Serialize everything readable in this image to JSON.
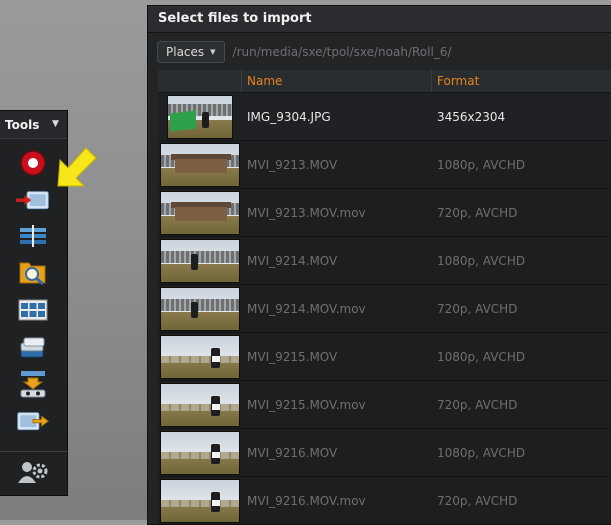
{
  "tools_panel": {
    "title": "Tools",
    "collapse_glyph": "▼",
    "tools": [
      {
        "name": "record-icon"
      },
      {
        "name": "import-icon"
      },
      {
        "name": "timeline-icon"
      },
      {
        "name": "media-browser-icon"
      },
      {
        "name": "grid-view-icon"
      },
      {
        "name": "stack-layers-icon"
      },
      {
        "name": "render-queue-icon"
      },
      {
        "name": "export-icon"
      },
      {
        "name": "users-settings-icon"
      }
    ]
  },
  "dialog": {
    "title": "Select files to import",
    "places_label": "Places",
    "path": "/run/media/sxe/tpol/sxe/noah/Roll_6/",
    "columns": {
      "name": "Name",
      "format": "Format"
    },
    "files": [
      {
        "name": "IMG_9304.JPG",
        "format": "3456x2304",
        "thumb": "greenscreen"
      },
      {
        "name": "MVI_9213.MOV",
        "format": "1080p, AVCHD",
        "thumb": "building"
      },
      {
        "name": "MVI_9213.MOV.mov",
        "format": "720p, AVCHD",
        "thumb": "building"
      },
      {
        "name": "MVI_9214.MOV",
        "format": "1080p, AVCHD",
        "thumb": "field-person"
      },
      {
        "name": "MVI_9214.MOV.mov",
        "format": "720p, AVCHD",
        "thumb": "field-person"
      },
      {
        "name": "MVI_9215.MOV",
        "format": "1080p, AVCHD",
        "thumb": "slate"
      },
      {
        "name": "MVI_9215.MOV.mov",
        "format": "720p, AVCHD",
        "thumb": "slate"
      },
      {
        "name": "MVI_9216.MOV",
        "format": "1080p, AVCHD",
        "thumb": "slate"
      },
      {
        "name": "MVI_9216.MOV.mov",
        "format": "720p, AVCHD",
        "thumb": "slate"
      }
    ]
  },
  "colors": {
    "column_header": "#e8821f",
    "active_text": "#e6e6e6",
    "inactive_text": "#6d7073",
    "pointer": "#f6e61a"
  }
}
